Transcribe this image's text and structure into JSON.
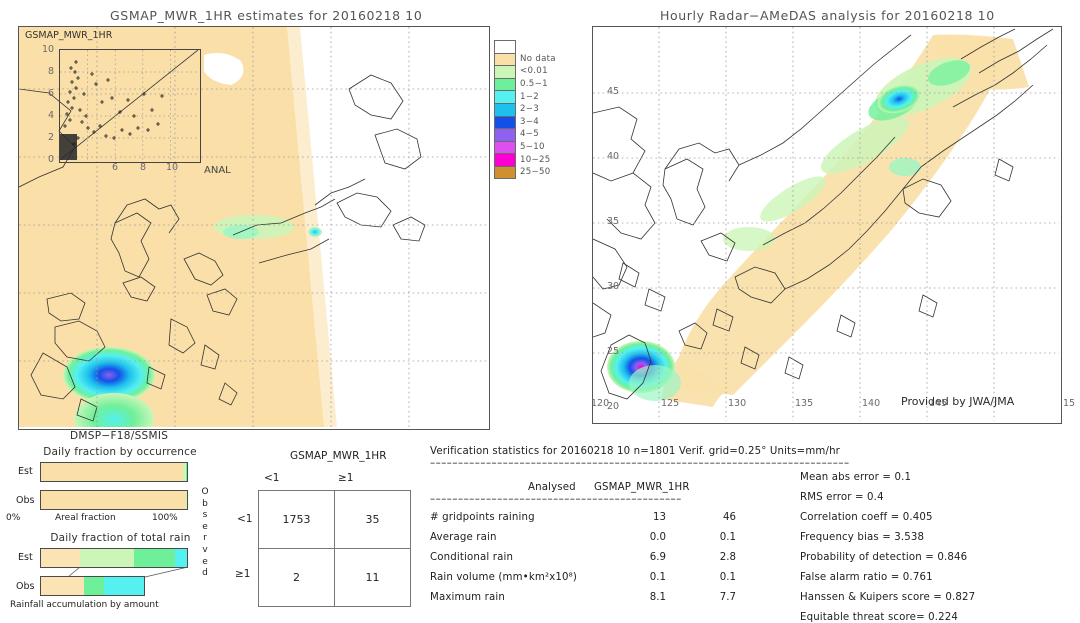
{
  "left_panel": {
    "title": "GSMAP_MWR_1HR estimates for 20160218 10",
    "inset_label": "GSMAP_MWR_1HR",
    "inset_xaxis_label": "ANAL",
    "inset_ticks": [
      "0",
      "2",
      "4",
      "6",
      "8",
      "10"
    ],
    "sensor_label": "DMSP−F18/SSMIS"
  },
  "right_panel": {
    "title": "Hourly Radar−AMeDAS analysis for 20160218 10",
    "credit": "Provided by JWA/JMA",
    "lon_ticks": [
      "120",
      "125",
      "130",
      "135",
      "140",
      "145",
      "15"
    ],
    "lat_ticks": [
      "45",
      "40",
      "35",
      "30",
      "25",
      "20"
    ]
  },
  "colorbar": {
    "levels": [
      {
        "label": "",
        "color": "#ffffff"
      },
      {
        "label": "No data",
        "color": "#fadfa8"
      },
      {
        "label": "<0.01",
        "color": "#ccf5b8"
      },
      {
        "label": "0.5−1",
        "color": "#6ef09a"
      },
      {
        "label": "1−2",
        "color": "#55f0f0"
      },
      {
        "label": "2−3",
        "color": "#1ec0ee"
      },
      {
        "label": "3−4",
        "color": "#1450e8"
      },
      {
        "label": "4−5",
        "color": "#9060f0"
      },
      {
        "label": "5−10",
        "color": "#dd50ee"
      },
      {
        "label": "10−25",
        "color": "#fa00d2"
      },
      {
        "label": "25−50",
        "color": "#cf9030"
      }
    ]
  },
  "occurrence_panel": {
    "title": "Daily fraction by occurrence",
    "row_est_label": "Est",
    "row_obs_label": "Obs",
    "axis_left": "0%",
    "axis_center": "Areal fraction",
    "axis_right": "100%",
    "est_segments": [
      {
        "color": "#fadfa8",
        "pct": 97.5
      },
      {
        "color": "#ccf5b8",
        "pct": 1.6
      },
      {
        "color": "#6ef09a",
        "pct": 0.9
      }
    ],
    "obs_segments": [
      {
        "color": "#fadfa8",
        "pct": 99.3
      },
      {
        "color": "#ccf5b8",
        "pct": 0.4
      },
      {
        "color": "#6ef09a",
        "pct": 0.3
      }
    ]
  },
  "totalrain_panel": {
    "title": "Daily fraction of total rain",
    "row_est_label": "Est",
    "row_obs_label": "Obs",
    "caption": "Rainfall accumulation by amount",
    "est_segments": [
      {
        "color": "#fce3b4",
        "pct": 27
      },
      {
        "color": "#ccf5b8",
        "pct": 37
      },
      {
        "color": "#6ef09a",
        "pct": 28
      },
      {
        "color": "#55f0f0",
        "pct": 8
      }
    ],
    "obs_segments": [
      {
        "color": "#fce3b4",
        "pct": 42
      },
      {
        "color": "#6ef09a",
        "pct": 19
      },
      {
        "color": "#55f0f0",
        "pct": 39
      }
    ]
  },
  "contingency": {
    "header": "GSMAP_MWR_1HR",
    "col_headers": [
      "<1",
      "≥1"
    ],
    "row_headers": [
      "<1",
      "≥1"
    ],
    "side_label": "Observed",
    "cells": [
      [
        "1753",
        "35"
      ],
      [
        "2",
        "11"
      ]
    ]
  },
  "verification": {
    "header": "Verification statistics for 20160218 10  n=1801  Verif. grid=0.25°  Units=mm/hr",
    "divider": "–––––––––––––––––––––––––––––––––––––––––––––––––––––––––––––––––––––––––––––––––––––––",
    "col_header_analysed": "Analysed",
    "col_header_model": "GSMAP_MWR_1HR",
    "divider2": "–––––––––––––––––––––––––––––––––––––––––––––",
    "rows": [
      {
        "label": "# gridpoints raining",
        "analysed": "13",
        "model": "46"
      },
      {
        "label": "Average rain",
        "analysed": "0.0",
        "model": "0.1"
      },
      {
        "label": "Conditional rain",
        "analysed": "6.9",
        "model": "2.8"
      },
      {
        "label": "Rain volume (mm•km²x10⁸)",
        "analysed": "0.1",
        "model": "0.1"
      },
      {
        "label": "Maximum rain",
        "analysed": "8.1",
        "model": "7.7"
      }
    ],
    "scores": [
      "Mean abs error = 0.1",
      "RMS error = 0.4",
      "Correlation coeff = 0.405",
      "Frequency bias = 3.538",
      "Probability of detection = 0.846",
      "False alarm ratio = 0.761",
      "Hanssen & Kuipers score = 0.827",
      "Equitable threat score= 0.224"
    ]
  }
}
